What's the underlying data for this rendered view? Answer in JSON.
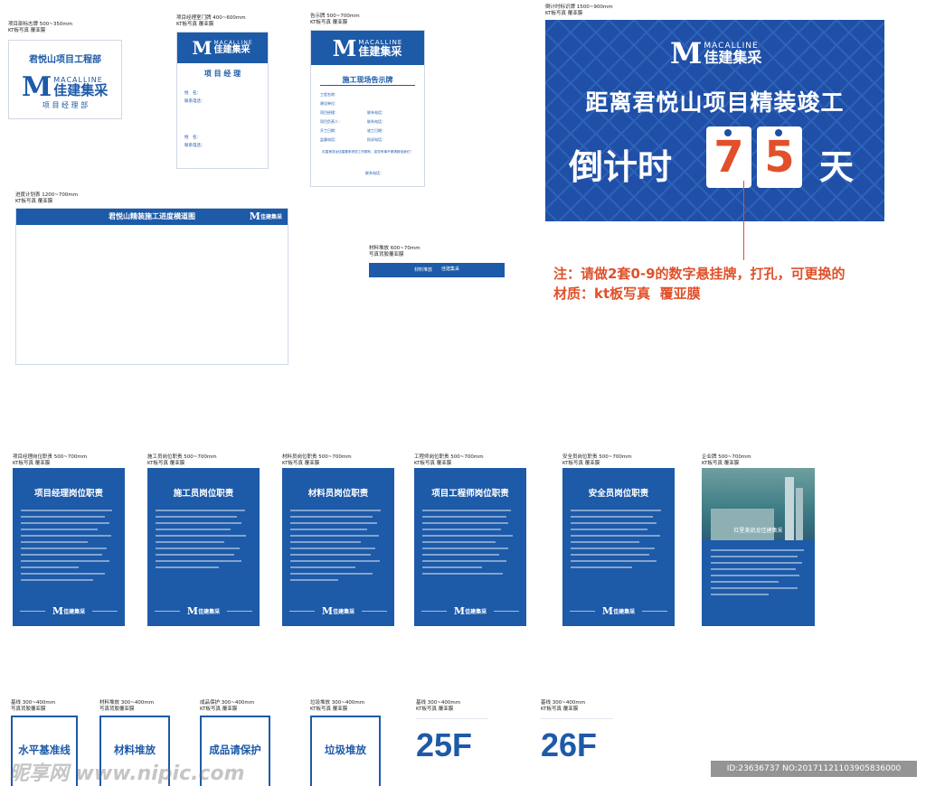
{
  "brand": {
    "en": "MACALLINE",
    "cn": "佳建集采",
    "m": "M",
    "accent": "#1d5aa8",
    "orange": "#e0502a"
  },
  "panels": {
    "dept_sign": {
      "spec": "项目部标志牌 500~350mm\nKT板写真 覆亚膜",
      "title": "君悦山项目工程部",
      "subtitle": "项 目 经 理 部"
    },
    "office_sign": {
      "spec": "项目经理室门牌 400~600mm\nKT板写真 覆亚膜",
      "heading": "项 目 经 理",
      "field1": "姓　名：",
      "field2": "联系电话：",
      "field3": "姓　名：",
      "field4": "联系电话："
    },
    "notice": {
      "spec": "告示牌 500~700mm\nKT板写真 覆亚膜",
      "heading": "施工现场告示牌",
      "fields": [
        "工程名称：",
        "建设单位：",
        "项目经理：",
        "项目负责人：",
        "开工日期：",
        "监督电话："
      ],
      "fields_right": [
        "联系电话：",
        "联系电话：",
        "竣工日期：",
        "投诉电话："
      ],
      "warning": "红星美凯龙佳建集采祝您工作顺利，如您有事不便请致电我们！",
      "sign": "联系电话："
    },
    "countdown": {
      "spec": "倒计时标识牌 1500~900mm\nKT板写真 覆亚膜",
      "line1": "距离君悦山项目精装竣工",
      "prefix": "倒计时",
      "digit1": "7",
      "digit2": "5",
      "suffix": "天",
      "note": "注：请做2套0-9的数字悬挂牌，打孔，可更换的\n材质：kt板写真  覆亚膜"
    },
    "progress": {
      "spec": "进度计划表 1200~700mm\nKT板写真 覆亚膜",
      "title": "君悦山精装施工进度横道图"
    },
    "material": {
      "spec": "材料堆放 600~70mm\n写真背胶覆亚膜",
      "text": "材料堆放"
    },
    "duties": [
      {
        "spec": "项目经理岗位职责 500~700mm\nKT板写真 覆亚膜",
        "title": "项目经理岗位职责"
      },
      {
        "spec": "施工员岗位职责 500~700mm\nKT板写真 覆亚膜",
        "title": "施工员岗位职责"
      },
      {
        "spec": "材料员岗位职责 500~700mm\nKT板写真 覆亚膜",
        "title": "材料员岗位职责"
      },
      {
        "spec": "工程师岗位职责 500~700mm\nKT板写真 覆亚膜",
        "title": "项目工程师岗位职责"
      },
      {
        "spec": "安全员岗位职责 500~700mm\nKT板写真 覆亚膜",
        "title": "安全员岗位职责"
      }
    ],
    "company": {
      "spec": "企业牌 500~700mm\nKT板写真 覆亚膜",
      "caption": "红星美凯龙佳建集采"
    },
    "small_signs": [
      {
        "spec": "基线 300~400mm\n写真背胶覆亚膜",
        "text": "水平基准线"
      },
      {
        "spec": "材料堆放 300~400mm\n写真背胶覆亚膜",
        "text": "材料堆放"
      },
      {
        "spec": "成品保护 300~400mm\nKT板写真 覆亚膜",
        "text": "成品请保护"
      },
      {
        "spec": "垃圾堆放 300~400mm\nKT板写真 覆亚膜",
        "text": "垃圾堆放"
      }
    ],
    "floors": [
      {
        "spec": "基线 300~400mm\nKT板写真 覆亚膜",
        "text": "25F"
      },
      {
        "spec": "基线 300~400mm\nKT板写真 覆亚膜",
        "text": "26F"
      }
    ]
  },
  "watermark": {
    "left": "昵享网 www.nipic.com",
    "right": "ID:23636737 NO:20171121103905836000"
  }
}
